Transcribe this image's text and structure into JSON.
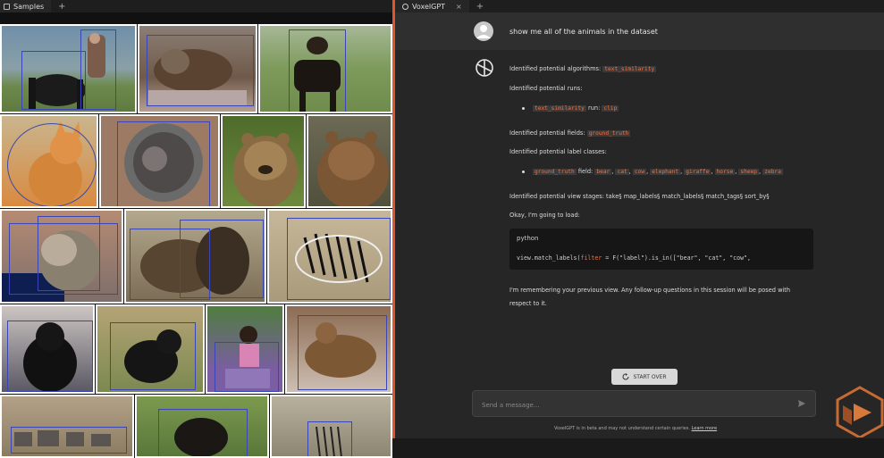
{
  "left_panel": {
    "tab_label": "Samples",
    "images": [
      {
        "subject": "horse with rider"
      },
      {
        "subject": "cat"
      },
      {
        "subject": "cow"
      },
      {
        "subject": "cat"
      },
      {
        "subject": "cat"
      },
      {
        "subject": "bear"
      },
      {
        "subject": "bear"
      },
      {
        "subject": "cat"
      },
      {
        "subject": "bear"
      },
      {
        "subject": "zebra"
      },
      {
        "subject": "cat"
      },
      {
        "subject": "cat"
      },
      {
        "subject": "person with dog"
      },
      {
        "subject": "cat"
      },
      {
        "subject": "elephant"
      },
      {
        "subject": "bear"
      },
      {
        "subject": "zebra"
      }
    ]
  },
  "right_panel": {
    "tab_label": "VoxelGPT",
    "user_message": "show me all of the animals in the dataset",
    "lines": {
      "algorithms_prefix": "Identified potential algorithms:",
      "algorithms_code": "text_similarity",
      "runs_label": "Identified potential runs:",
      "run_key": "text_similarity",
      "run_word": "run:",
      "run_val": "clip",
      "fields_prefix": "Identified potential fields:",
      "fields_code": "ground_truth",
      "classes_label": "Identified potential label classes:",
      "classes_field_code": "ground_truth",
      "classes_field_word": "field:",
      "classes": [
        "bear",
        "cat",
        "cow",
        "elephant",
        "giraffe",
        "horse",
        "sheep",
        "zebra"
      ],
      "stages": "Identified potential view stages: take§ map_labels§ match_labels§ match_tags§ sort_by§",
      "loading": "Okay, I'm going to load:",
      "code_lang": "python",
      "code_p1": "view.match_labels(",
      "code_kw": "filter",
      "code_p2": " = F(\"label\").is_in([\"bear\", \"cat\", \"cow\",",
      "remember1": "I'm remembering your previous view. Any follow-up questions in this session will be posed with",
      "remember2": "respect to it."
    },
    "start_over": "START OVER",
    "input_placeholder": "Send a message...",
    "footnote": "VoxelGPT is in beta and may not understand certain queries.",
    "footnote_link": "Learn more"
  },
  "colors": {
    "accent": "#e0562a",
    "code": "#e7744a",
    "bbox": "#3a46b8"
  }
}
